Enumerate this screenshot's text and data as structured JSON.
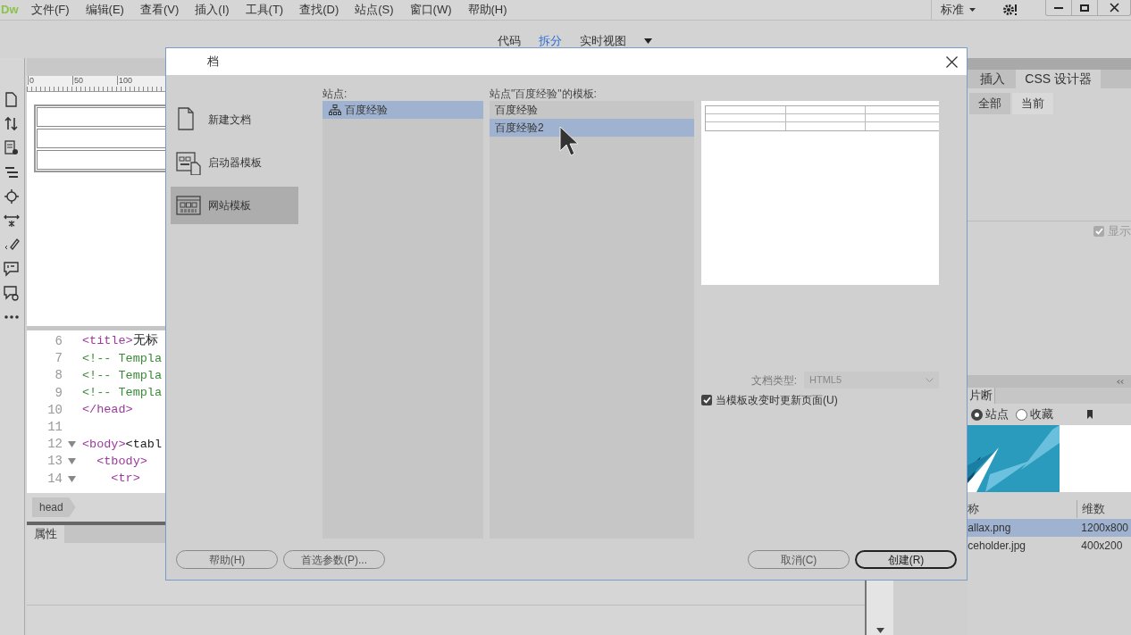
{
  "app": {
    "logo": "Dw",
    "menu": [
      "文件(F)",
      "编辑(E)",
      "查看(V)",
      "插入(I)",
      "工具(T)",
      "查找(D)",
      "站点(S)",
      "窗口(W)",
      "帮助(H)"
    ],
    "workspace": "标准"
  },
  "view_switch": [
    {
      "label": "代码",
      "selected": false
    },
    {
      "label": "拆分",
      "selected": true
    },
    {
      "label": "实时视图",
      "selected": false
    }
  ],
  "ruler_labels": [
    "0",
    "50",
    "100"
  ],
  "code_lines": [
    {
      "number": "6",
      "text": "<title>无标",
      "kind": "tag",
      "foldable": false
    },
    {
      "number": "7",
      "text": "<!-- Templa",
      "kind": "comment",
      "foldable": false
    },
    {
      "number": "8",
      "text": "<!-- Templa",
      "kind": "comment",
      "foldable": false
    },
    {
      "number": "9",
      "text": "<!-- Templa",
      "kind": "comment",
      "foldable": false
    },
    {
      "number": "10",
      "text": "</head>",
      "kind": "tag",
      "foldable": false
    },
    {
      "number": "11",
      "kind": "blank",
      "foldable": false
    },
    {
      "number": "12",
      "text": "<body><tabl",
      "kind": "tag",
      "foldable": true
    },
    {
      "number": "13",
      "text": "  <tbody>",
      "kind": "tag",
      "foldable": true
    },
    {
      "number": "14",
      "text": "    <tr>",
      "kind": "tag",
      "foldable": true
    }
  ],
  "tag_selector": "head",
  "properties_tab": "属性",
  "right_panel": {
    "tabs": [
      {
        "label": "插入",
        "selected": false
      },
      {
        "label": "CSS 设计器",
        "selected": true
      }
    ],
    "filters": [
      {
        "label": "全部",
        "selected": true
      },
      {
        "label": "当前",
        "selected": false
      }
    ],
    "show_option": {
      "label": "显示",
      "checked": true
    }
  },
  "assets_panel": {
    "tab": "片断",
    "scopes": [
      {
        "label": "站点",
        "selected": true
      },
      {
        "label": "收藏",
        "selected": false
      }
    ],
    "columns": [
      "称",
      "维数"
    ],
    "rows": [
      {
        "name": "allax.png",
        "size": "1200x800",
        "selected": true
      },
      {
        "name": "ceholder.jpg",
        "size": "400x200",
        "selected": false
      }
    ]
  },
  "dialog": {
    "title": "档",
    "categories": [
      {
        "label": "新建文档",
        "kind": "document",
        "selected": false
      },
      {
        "label": "启动器模板",
        "kind": "starter",
        "selected": false
      },
      {
        "label": "网站模板",
        "kind": "site",
        "selected": true
      }
    ],
    "sites_label": "站点:",
    "sites": [
      {
        "label": "百度经验",
        "selected": true
      }
    ],
    "templates_label": "站点\"百度经验\"的模板:",
    "templates": [
      {
        "label": "百度经验",
        "selected": false
      },
      {
        "label": "百度经验2",
        "selected": true
      }
    ],
    "doc_type_label": "文档类型:",
    "doc_type": {
      "value": "HTML5",
      "disabled": true
    },
    "update_pages": {
      "label": "当模板改变时更新页面(U)",
      "checked": true
    },
    "buttons_left": [
      {
        "label": "帮助(H)",
        "default": false
      },
      {
        "label": "首选参数(P)...",
        "default": false
      }
    ],
    "buttons_right": [
      {
        "label": "取消(C)",
        "default": false
      },
      {
        "label": "创建(R)",
        "default": true
      }
    ]
  }
}
